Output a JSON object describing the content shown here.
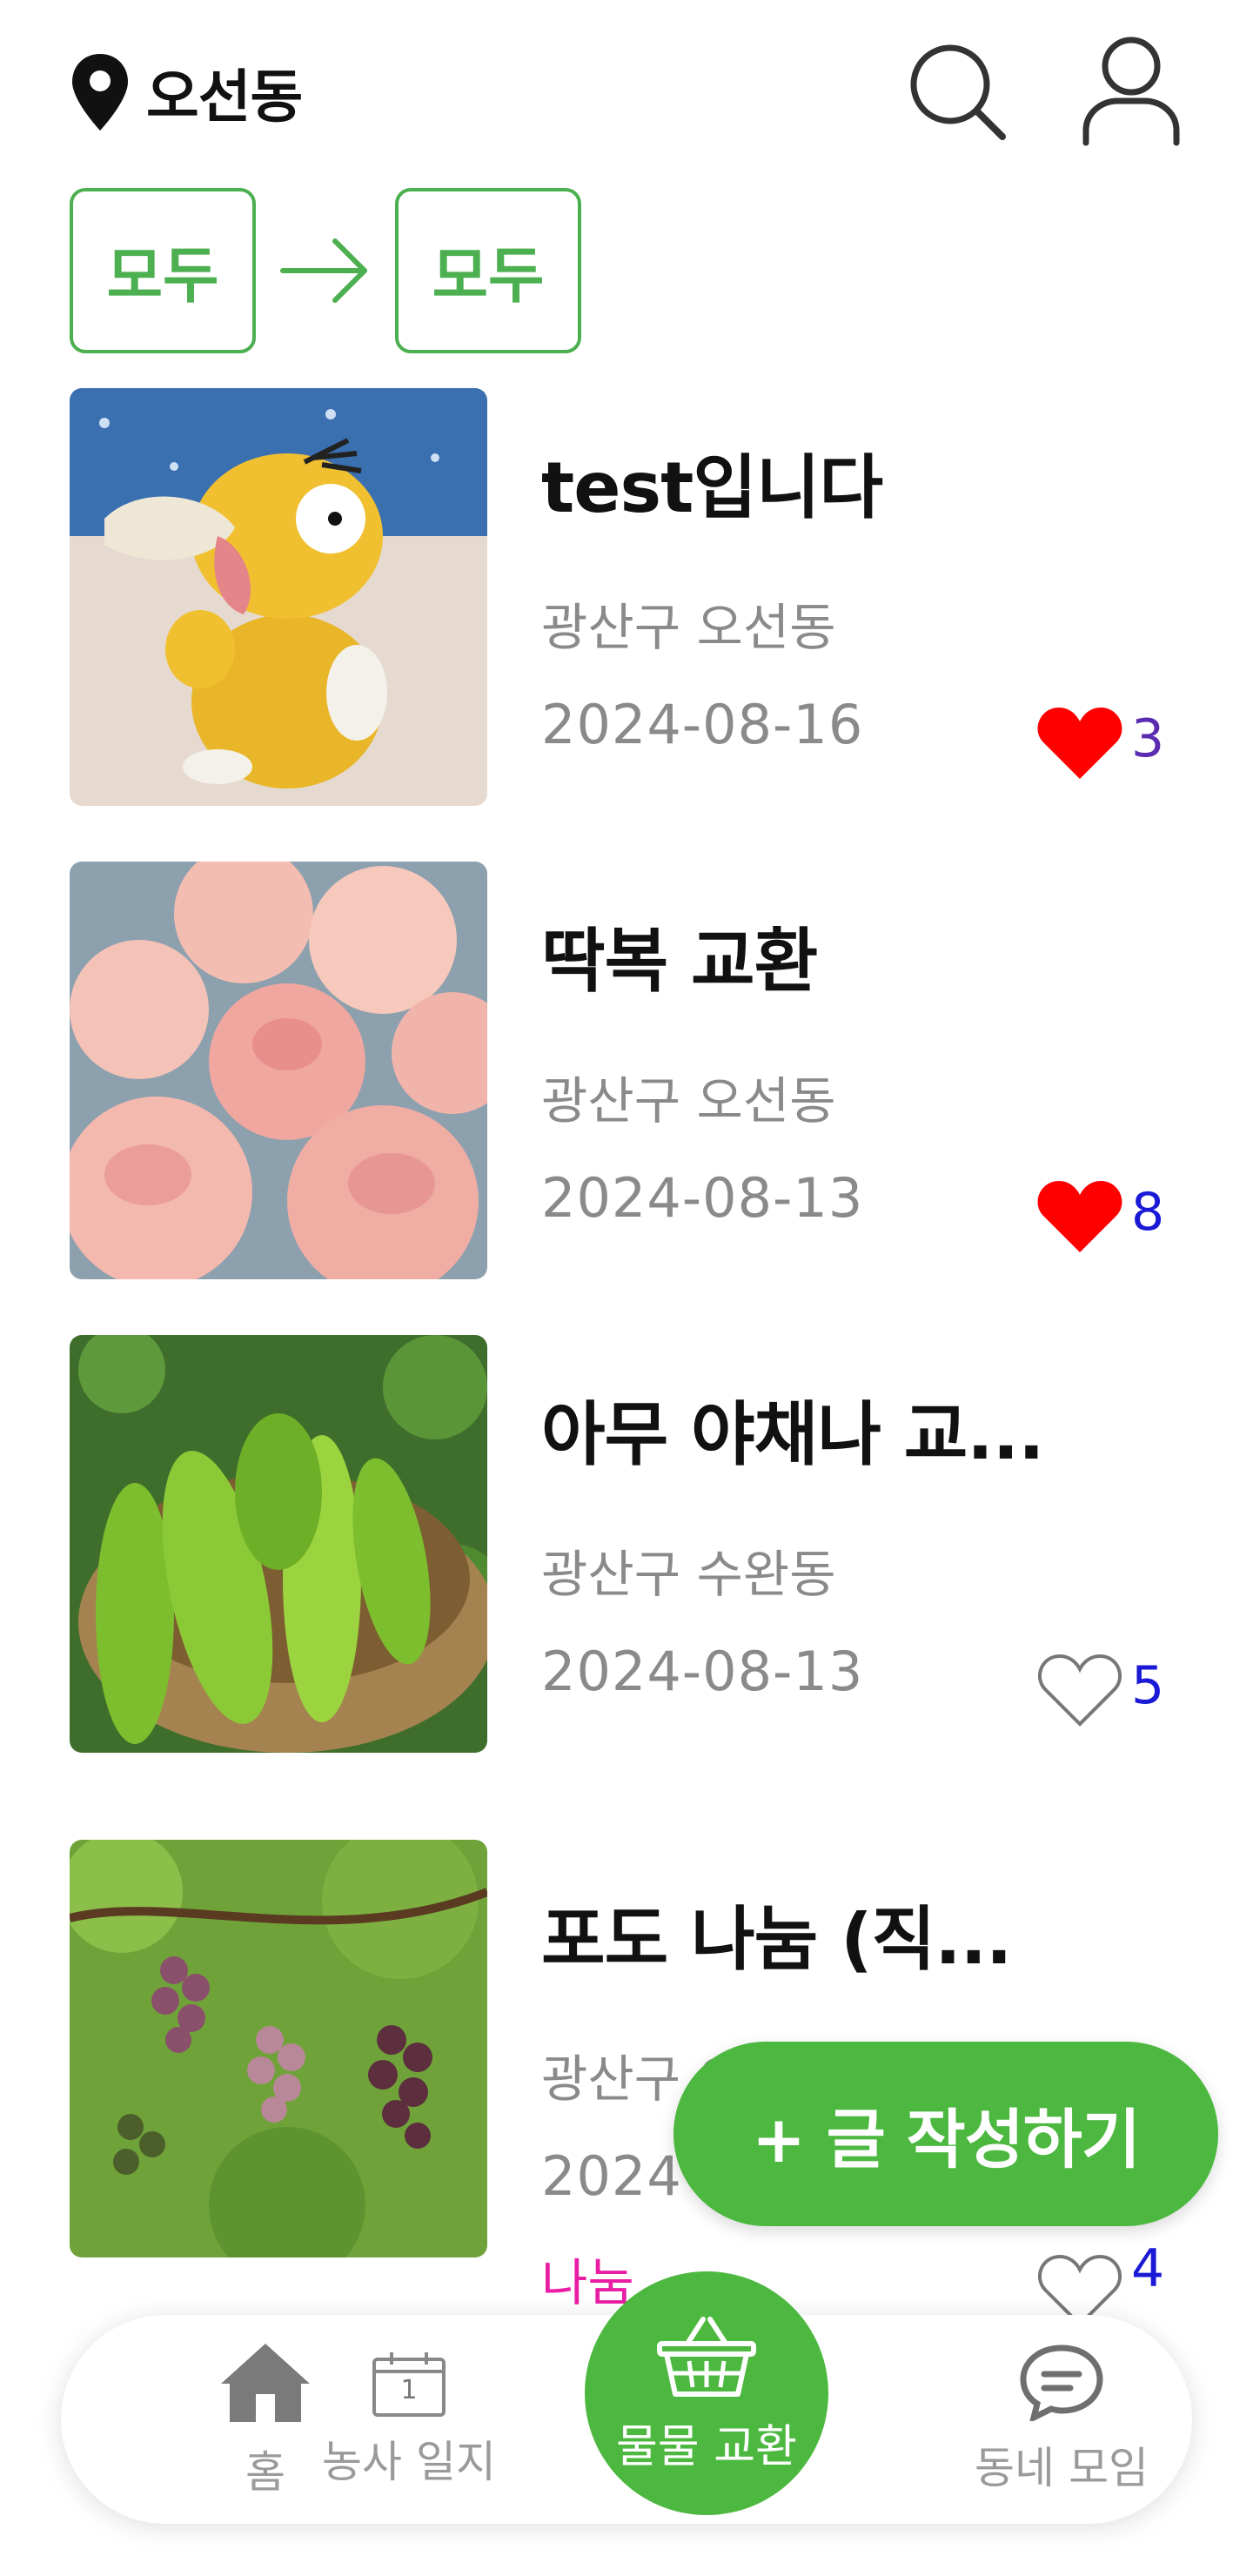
{
  "header": {
    "location": "오선동"
  },
  "filter": {
    "from": "모두",
    "to": "모두"
  },
  "posts": [
    {
      "title": "test입니다",
      "address": "광산구 오선동",
      "date": "2024-08-16",
      "likes": "3",
      "liked": true,
      "count_color": "#5B2BB0"
    },
    {
      "title": "딱복 교환",
      "address": "광산구 오선동",
      "date": "2024-08-13",
      "likes": "8",
      "liked": true,
      "count_color": "#1a1ad6"
    },
    {
      "title": "아무 야채나 교...",
      "address": "광산구 수완동",
      "date": "2024-08-13",
      "likes": "5",
      "liked": false,
      "count_color": "#1a1ad6"
    },
    {
      "title": "포도 나눔 (직...",
      "address": "광산구 오선동",
      "date": "2024",
      "likes": "4",
      "liked": false,
      "tag": "나눔",
      "count_color": "#1a1ad6"
    }
  ],
  "fab": {
    "label": "+ 글 작성하기"
  },
  "nav": {
    "home": "홈",
    "diary": "농사 일지",
    "diary_day": "1",
    "exchange": "물물 교환",
    "meet": "동네 모임"
  },
  "colors": {
    "accent": "#4DB840",
    "heart": "#FF0000",
    "tag": "#E91EA5"
  }
}
